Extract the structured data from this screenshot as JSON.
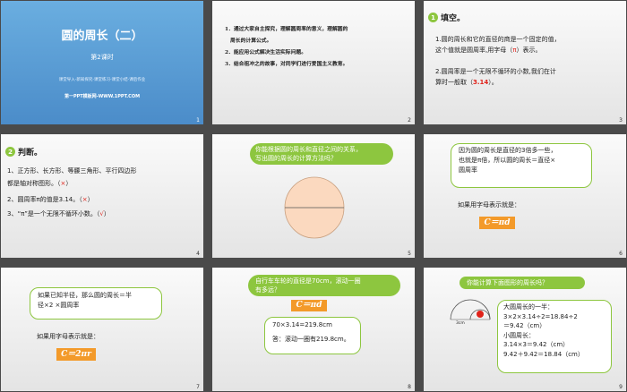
{
  "colors": {
    "accent": "#8dc63f",
    "highlight": "#e0221a",
    "formula_bg": "#f39a2a",
    "title_bg": "#5fa0d6"
  },
  "slides": [
    {
      "num": "1",
      "title": "圆的周长（二）",
      "subtitle": "第2课时",
      "nav": "课堂导入-新知探究-课堂练习-课堂小结-课后作业",
      "footer": "第一PPT模板网-WWW.1PPT.COM"
    },
    {
      "num": "2",
      "objectives": [
        "1．通过大家自主探究，理解圆周率的意义，理解圆的",
        "周长的计算公式。",
        "2．能应用公式解决生活实际问题。",
        "3．结合祖冲之的故事，对同学们进行爱国主义教育。"
      ]
    },
    {
      "num": "3",
      "badge": "1",
      "heading": "填空。",
      "q1a": "1.圆的周长和它的直径的商是一个固定的值，",
      "q1b": "这个值就是圆周率,用字母（",
      "q1ans": "π",
      "q1c": "）表示。",
      "q2a": "2.圆周率是一个无限不循环的小数,我们在计",
      "q2b": "算时一般取（",
      "q2ans": "3.14",
      "q2c": "）。"
    },
    {
      "num": "4",
      "badge": "2",
      "heading": "判断。",
      "l1a": "1、正方形、长方形、等腰三角形、平行四边形",
      "l1b": "都是轴对称图形。（",
      "l1m": "×",
      "l1c": "）",
      "l2a": "2、圆周率π的值是3.14。（",
      "l2m": "×",
      "l2c": "）",
      "l3a": "3、“π”是一个无限不循环小数。（",
      "l3m": "√",
      "l3c": "）"
    },
    {
      "num": "5",
      "bubble1": "你能根据圆的周长和直径之间的关系，",
      "bubble2": "写出圆的周长的计算方法吗？"
    },
    {
      "num": "6",
      "note1": "因为圆的周长是直径的3倍多一些，",
      "note2": "也就是π倍，所以圆的周长＝直径×",
      "note3": "圆周率",
      "text": "如果用字母表示就是：",
      "formula": "C＝πd"
    },
    {
      "num": "7",
      "note1": "如果已知半径，那么圆的周长＝半",
      "note2": "径×2 ×圆周率",
      "text": "如果用字母表示就是：",
      "formula": "C＝2πr"
    },
    {
      "num": "8",
      "bubble1": "自行车车轮的直径是70cm，滚动一圈",
      "bubble2": "有多远？",
      "formula": "C＝πd",
      "calc": "70×3.14=219.8cm",
      "answer": "答：滚动一圈有219.8cm。"
    },
    {
      "num": "9",
      "bubble": "你能计算下面图形的周长吗？",
      "label": "3cm",
      "lines": [
        "大圆周长的一半：",
        "3×2×3.14÷2=18.84÷2",
        "＝9.42（cm）",
        "小圆周长：",
        "3.14×3＝9.42（cm）",
        "9.42＋9.42＝18.84（cm）"
      ]
    }
  ]
}
